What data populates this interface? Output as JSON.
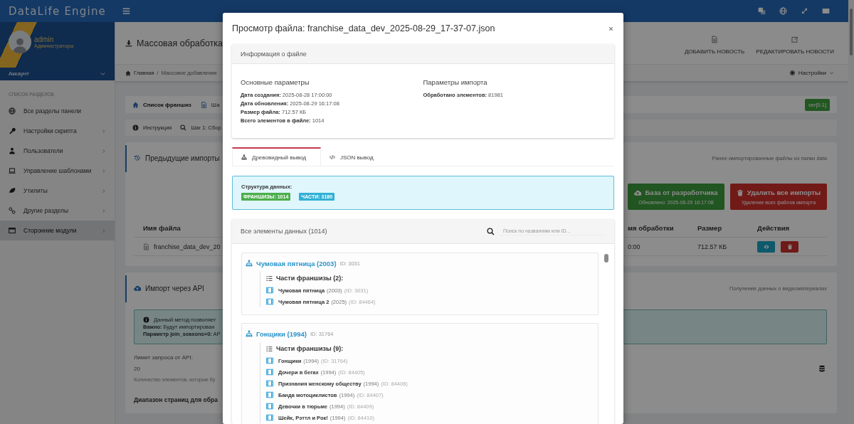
{
  "header": {
    "logo": "DataLife Engine"
  },
  "user": {
    "name": "admin",
    "group": "Администраторы",
    "account": "Аккаунт"
  },
  "sidebar": {
    "heading": "СПИСОК РАЗДЕЛОВ",
    "items": [
      {
        "label": "Все разделы панели",
        "has_submenu": false,
        "selected": false
      },
      {
        "label": "Настройки скрипта",
        "has_submenu": true,
        "selected": false
      },
      {
        "label": "Пользователи",
        "has_submenu": true,
        "selected": false
      },
      {
        "label": "Управление шаблонами",
        "has_submenu": true,
        "selected": false
      },
      {
        "label": "Утилиты",
        "has_submenu": true,
        "selected": false
      },
      {
        "label": "Другие разделы",
        "has_submenu": true,
        "selected": false
      },
      {
        "label": "Сторонние модули",
        "has_submenu": true,
        "selected": true
      }
    ]
  },
  "page": {
    "title": "Массовая обработка",
    "actions": [
      "ДОБАВИТЬ НОВОСТЬ",
      "РЕДАКТИРОВАТЬ НОВОСТИ"
    ],
    "breadcrumb": [
      "Главная",
      "Массовое добавление"
    ],
    "breadcrumb_separator": "/",
    "settings": "Настройки"
  },
  "module": {
    "tabs": [
      {
        "label": "Список франшиз",
        "selected": true
      },
      {
        "label": "Ша",
        "selected": false
      }
    ],
    "version": "ver[0.1]",
    "steps": [
      "Инструкция",
      "Шаг 1: Сбор"
    ]
  },
  "previous_imports": {
    "title": "Предыдущие импорты",
    "subtitle": "Ранее импортированные файлы из папки data",
    "buttons": [
      {
        "kind": "success",
        "label": "База от разработчика",
        "note": "Обновлено: 2025-08-29 16:17:08"
      },
      {
        "kind": "danger",
        "label": "Удалить все импорты",
        "note": "Удаление всех файлов импорта"
      }
    ],
    "table": {
      "columns": [
        "Имя файла",
        "мя обработки",
        "Размер",
        "Действия"
      ],
      "rows": [
        {
          "file": "franchise_data_dev_20",
          "time": "0:00",
          "size": "712.57 КБ"
        }
      ]
    }
  },
  "api_import": {
    "title": "Импорт через API",
    "subtitle": "Получение данных о видеоматериалах",
    "alert": [
      "Данный метод позволяет",
      "**Важно:** Будут импортирован",
      "**Параметр join_seasons=0:** AP"
    ],
    "limit": {
      "label": "Лимит запроса от API:",
      "value": "20",
      "hint": "Количество элементов, которые бу"
    },
    "range_label": "Диапазон страниц для обра"
  },
  "modal": {
    "title": "Просмотр файла: franchise_data_dev_2025-08-29_17-37-07.json",
    "info": {
      "title": "Информация о файле",
      "groups": [
        {
          "heading": "Основные параметры",
          "fields": [
            "**Дата создания:** 2025-08-28 17:00:00",
            "**Дата обновления:** 2025-08-29 16:17:08",
            "**Размер файла:** 712.57 КБ",
            "**Всего элементов в файле:** 1014"
          ]
        },
        {
          "heading": "Параметры импорта",
          "fields": [
            "**Обработано элементов:** 81981"
          ]
        }
      ]
    },
    "tabs": [
      {
        "label": "Древовидный вывод",
        "selected": true
      },
      {
        "label": "JSON вывод",
        "selected": false
      }
    ],
    "structure": {
      "title": "Структура данных:",
      "badges": [
        {
          "label": "ФРАНШИЗЫ: 1014",
          "color": "#4cae4c"
        },
        {
          "label": "ЧАСТИ: 3180",
          "color": "#31b0d5"
        }
      ]
    },
    "elements": {
      "title": "Все элементы данных (1014)",
      "search": {
        "placeholder": "Поиск по названиям или ID..."
      },
      "franchises": [
        {
          "title": "Чумовая пятница (2003)",
          "id": "ID: 3031",
          "parts_title": "Части франшизы (2):",
          "parts": [
            {
              "name": "Чумовая пятница",
              "year": "(2003)",
              "id": "(ID: 3031)"
            },
            {
              "name": "Чумовая пятница 2",
              "year": "(2025)",
              "id": "(ID: 84464)"
            }
          ]
        },
        {
          "title": "Гонщики (1994)",
          "id": "ID: 31764",
          "parts_title": "Части франшизы (9):",
          "parts": [
            {
              "name": "Гонщики",
              "year": "(1994)",
              "id": "(ID: 31764)"
            },
            {
              "name": "Дочери в бегах",
              "year": "(1994)",
              "id": "(ID: 84405)"
            },
            {
              "name": "Признания женскому обществу",
              "year": "(1994)",
              "id": "(ID: 84406)"
            },
            {
              "name": "Банда мотоциклистов",
              "year": "(1994)",
              "id": "(ID: 84407)"
            },
            {
              "name": "Девочки в тюрьме",
              "year": "(1994)",
              "id": "(ID: 84409)"
            },
            {
              "name": "Шейк, Рэттл и Рок!",
              "year": "(1994)",
              "id": "(ID: 84410)"
            }
          ]
        }
      ]
    }
  }
}
